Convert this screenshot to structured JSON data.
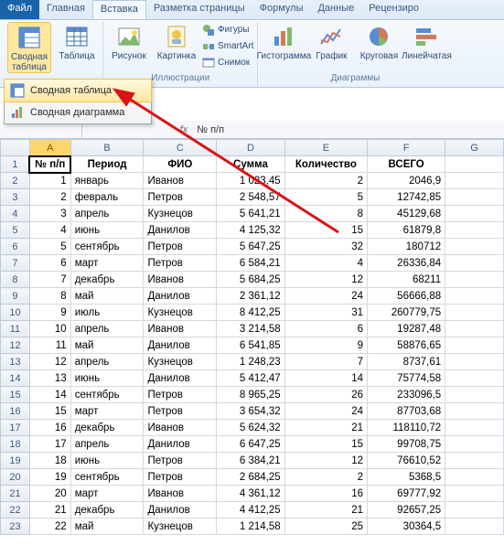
{
  "tabs": {
    "file": "Файл",
    "home": "Главная",
    "insert": "Вставка",
    "layout": "Разметка страницы",
    "formulas": "Формулы",
    "data": "Данные",
    "review": "Рецензиро"
  },
  "ribbon": {
    "pivot": {
      "label": "Сводная\nтаблица",
      "dd_table": "Сводная таблица",
      "dd_chart": "Сводная диаграмма"
    },
    "table": "Таблица",
    "picture": "Рисунок",
    "clipart": "Картинка",
    "shapes": "Фигуры",
    "smartart": "SmartArt",
    "screenshot": "Снимок",
    "illus_group": "Иллюстрации",
    "histogram": "Гистограмма",
    "line": "График",
    "pie": "Круговая",
    "bar": "Линейчатая",
    "charts_group": "Диаграммы"
  },
  "formula_bar": {
    "name": "",
    "fx": "fx",
    "value": "№ п/п"
  },
  "col_headers": [
    "A",
    "B",
    "C",
    "D",
    "E",
    "F",
    "G"
  ],
  "header_row": [
    "№ п/п",
    "Период",
    "ФИО",
    "Сумма",
    "Количество",
    "ВСЕГО"
  ],
  "rows": [
    {
      "n": "1",
      "period": "январь",
      "fio": "Иванов",
      "sum": "1 023,45",
      "qty": "2",
      "total": "2046,9"
    },
    {
      "n": "2",
      "period": "февраль",
      "fio": "Петров",
      "sum": "2 548,57",
      "qty": "5",
      "total": "12742,85"
    },
    {
      "n": "3",
      "period": "апрель",
      "fio": "Кузнецов",
      "sum": "5 641,21",
      "qty": "8",
      "total": "45129,68"
    },
    {
      "n": "4",
      "period": "июнь",
      "fio": "Данилов",
      "sum": "4 125,32",
      "qty": "15",
      "total": "61879,8"
    },
    {
      "n": "5",
      "period": "сентябрь",
      "fio": "Петров",
      "sum": "5 647,25",
      "qty": "32",
      "total": "180712"
    },
    {
      "n": "6",
      "period": "март",
      "fio": "Петров",
      "sum": "6 584,21",
      "qty": "4",
      "total": "26336,84"
    },
    {
      "n": "7",
      "period": "декабрь",
      "fio": "Иванов",
      "sum": "5 684,25",
      "qty": "12",
      "total": "68211"
    },
    {
      "n": "8",
      "period": "май",
      "fio": "Данилов",
      "sum": "2 361,12",
      "qty": "24",
      "total": "56666,88"
    },
    {
      "n": "9",
      "period": "июль",
      "fio": "Кузнецов",
      "sum": "8 412,25",
      "qty": "31",
      "total": "260779,75"
    },
    {
      "n": "10",
      "period": "апрель",
      "fio": "Иванов",
      "sum": "3 214,58",
      "qty": "6",
      "total": "19287,48"
    },
    {
      "n": "11",
      "period": "май",
      "fio": "Данилов",
      "sum": "6 541,85",
      "qty": "9",
      "total": "58876,65"
    },
    {
      "n": "12",
      "period": "апрель",
      "fio": "Кузнецов",
      "sum": "1 248,23",
      "qty": "7",
      "total": "8737,61"
    },
    {
      "n": "13",
      "period": "июнь",
      "fio": "Данилов",
      "sum": "5 412,47",
      "qty": "14",
      "total": "75774,58"
    },
    {
      "n": "14",
      "period": "сентябрь",
      "fio": "Петров",
      "sum": "8 965,25",
      "qty": "26",
      "total": "233096,5"
    },
    {
      "n": "15",
      "period": "март",
      "fio": "Петров",
      "sum": "3 654,32",
      "qty": "24",
      "total": "87703,68"
    },
    {
      "n": "16",
      "period": "декабрь",
      "fio": "Иванов",
      "sum": "5 624,32",
      "qty": "21",
      "total": "118110,72"
    },
    {
      "n": "17",
      "period": "апрель",
      "fio": "Данилов",
      "sum": "6 647,25",
      "qty": "15",
      "total": "99708,75"
    },
    {
      "n": "18",
      "period": "июнь",
      "fio": "Петров",
      "sum": "6 384,21",
      "qty": "12",
      "total": "76610,52"
    },
    {
      "n": "19",
      "period": "сентябрь",
      "fio": "Петров",
      "sum": "2 684,25",
      "qty": "2",
      "total": "5368,5"
    },
    {
      "n": "20",
      "period": "март",
      "fio": "Иванов",
      "sum": "4 361,12",
      "qty": "16",
      "total": "69777,92"
    },
    {
      "n": "21",
      "period": "декабрь",
      "fio": "Данилов",
      "sum": "4 412,25",
      "qty": "21",
      "total": "92657,25"
    },
    {
      "n": "22",
      "period": "май",
      "fio": "Кузнецов",
      "sum": "1 214,58",
      "qty": "25",
      "total": "30364,5"
    }
  ]
}
